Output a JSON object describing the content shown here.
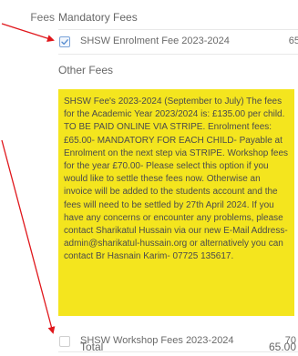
{
  "fees_label": "Fees",
  "mandatory": {
    "heading": "Mandatory Fees",
    "items": [
      {
        "name": "SHSW Enrolment Fee 2023-2024",
        "amount": "65",
        "checked": true
      }
    ]
  },
  "other": {
    "heading": "Other Fees",
    "notice": "SHSW Fee's 2023-2024 (September to July) The fees for the Academic Year 2023/2024 is: £135.00 per child. TO BE PAID ONLINE VIA STRIPE. Enrolment fees: £65.00- MANDATORY FOR EACH CHILD- Payable at Enrolment on the next step via STRIPE. Workshop fees for the year £70.00- Please select this option if you would like to settle these fees now. Otherwise an invoice will be added to the students account and the fees will need to be settled by 27th April 2024. If you have any concerns or encounter any problems, please contact Sharikatul Hussain via our new E-Mail Address- admin@sharikatul-hussain.org or alternatively you can contact Br Hasnain Karim- 07725 135617.",
    "items": [
      {
        "name": "SHSW Workshop Fees 2023-2024",
        "amount": "70",
        "checked": false
      }
    ]
  },
  "total": {
    "label": "Total",
    "value": "65.00"
  },
  "colors": {
    "notice_background": "#f4e51e",
    "annotation_arrow": "#e0161b",
    "checkbox_checked": "#7aa3d8"
  }
}
